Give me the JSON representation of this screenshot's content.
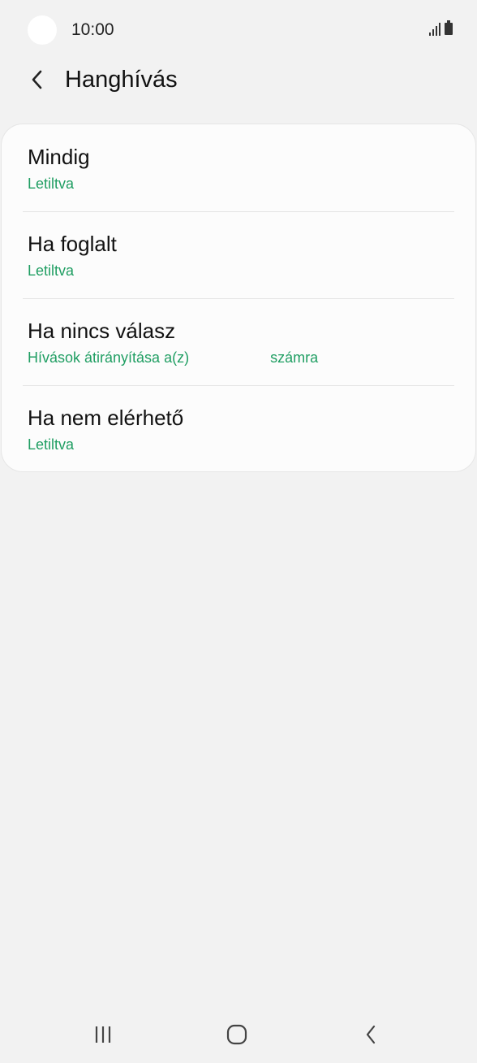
{
  "status_bar": {
    "time": "10:00",
    "icons": [
      "camera-cutout",
      "signal-icon",
      "battery-icon"
    ]
  },
  "header": {
    "back_icon": "chevron-left-icon",
    "title": "Hanghívás"
  },
  "colors": {
    "accent_green": "#1f9e62",
    "background": "#f2f2f2",
    "card": "#fcfcfc"
  },
  "items": [
    {
      "title": "Mindig",
      "subtitle": "Letiltva"
    },
    {
      "title": "Ha foglalt",
      "subtitle": "Letiltva"
    },
    {
      "title": "Ha nincs válasz",
      "subtitle_part1": "Hívások átirányítása a(z)",
      "subtitle_part2": "számra"
    },
    {
      "title": "Ha nem elérhető",
      "subtitle": "Letiltva"
    }
  ],
  "nav_bar": {
    "buttons": [
      "recent-apps-icon",
      "home-icon",
      "back-icon"
    ]
  }
}
